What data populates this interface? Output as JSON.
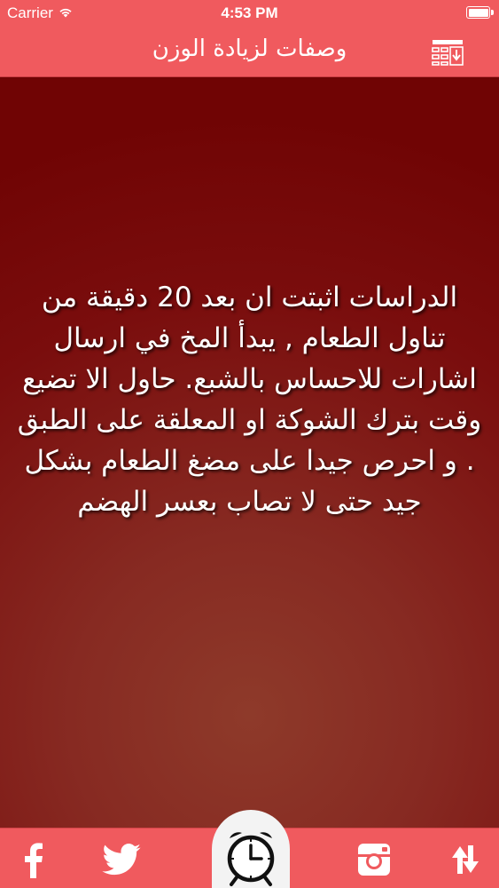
{
  "status_bar": {
    "carrier": "Carrier",
    "time": "4:53 PM"
  },
  "nav": {
    "title": "وصفات لزيادة الوزن",
    "action_icon": "download-list-icon"
  },
  "article": {
    "text": "الدراسات اثبتت ان بعد 20 دقيقة من تناول الطعام , يبدأ المخ في ارسال اشارات للاحساس بالشبع.  حاول الا تضيع وقت بترك الشوكة او المعلقة على الطبق . و احرص جيدا على مضغ الطعام بشكل جيد حتى لا تصاب بعسر الهضم"
  },
  "tab_bar": {
    "items": [
      {
        "icon": "facebook-icon"
      },
      {
        "icon": "twitter-icon"
      },
      {
        "icon": "alarm-clock-icon"
      },
      {
        "icon": "instagram-icon"
      },
      {
        "icon": "shuffle-icon"
      }
    ]
  },
  "colors": {
    "accent": "#f05a5e",
    "background_dark": "#700404",
    "background_light": "#8e3a2a",
    "text": "#ffffff"
  }
}
